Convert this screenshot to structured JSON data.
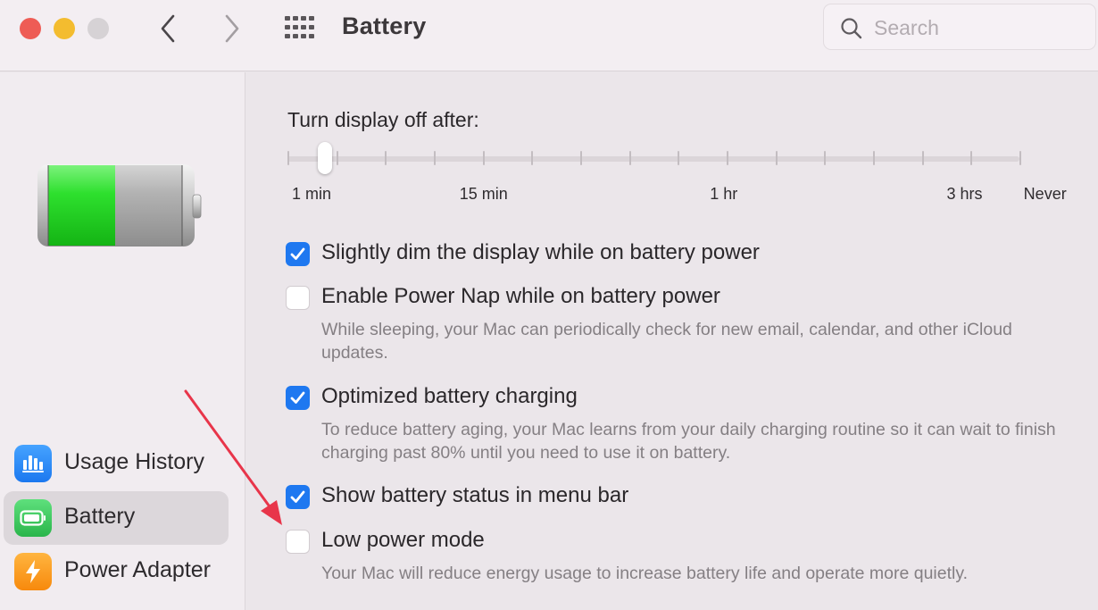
{
  "window": {
    "title": "Battery",
    "search": {
      "placeholder": "Search",
      "value": ""
    }
  },
  "sidebar": {
    "battery_charge_fraction": 0.5,
    "items": [
      {
        "label": "Usage History",
        "icon": "bar-chart-icon",
        "selected": false
      },
      {
        "label": "Battery",
        "icon": "battery-icon",
        "selected": true
      },
      {
        "label": "Power Adapter",
        "icon": "lightning-bolt-icon",
        "selected": false
      }
    ]
  },
  "main": {
    "display_off": {
      "label": "Turn display off after:",
      "selected_value": "1 min",
      "tick_count": 16,
      "selected_tick_fraction": 0.04,
      "tick_labels": [
        {
          "text": "1 min",
          "fraction": 0.033
        },
        {
          "text": "15 min",
          "fraction": 0.268
        },
        {
          "text": "1 hr",
          "fraction": 0.596
        },
        {
          "text": "3 hrs",
          "fraction": 0.925
        },
        {
          "text": "Never",
          "fraction": 1.035
        }
      ]
    },
    "options": [
      {
        "label": "Slightly dim the display while on battery power",
        "checked": true,
        "description": ""
      },
      {
        "label": "Enable Power Nap while on battery power",
        "checked": false,
        "description": "While sleeping, your Mac can periodically check for new email, calendar, and other iCloud updates."
      },
      {
        "label": "Optimized battery charging",
        "checked": true,
        "description": "To reduce battery aging, your Mac learns from your daily charging routine so it can wait to finish charging past 80% until you need to use it on battery."
      },
      {
        "label": "Show battery status in menu bar",
        "checked": true,
        "description": ""
      },
      {
        "label": "Low power mode",
        "checked": false,
        "description": "Your Mac will reduce energy usage to increase battery life and operate more quietly."
      }
    ]
  },
  "annotation": {
    "type": "arrow",
    "color": "#e8354a",
    "points_to": "Low power mode"
  },
  "colors": {
    "accent": "#1e78f0",
    "close": "#ee5c55",
    "minimize": "#f3bc2f",
    "zoom": "#d6d2d5"
  }
}
